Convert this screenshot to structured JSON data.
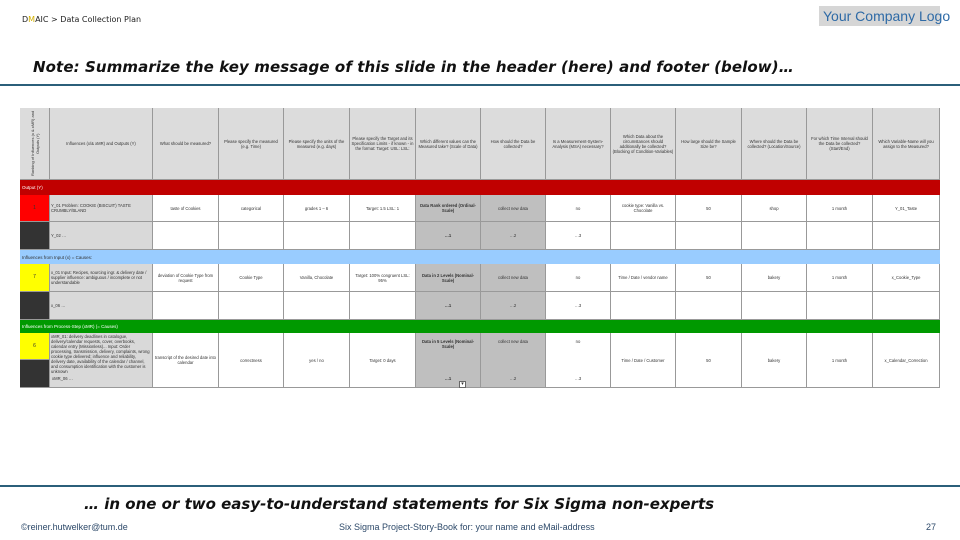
{
  "header": {
    "breadcrumb_prefix": "D",
    "breadcrumb_highlight": "M",
    "breadcrumb_suffix": "AIC > Data Collection Plan",
    "logo": "Your Company Logo",
    "note_top": "Note: Summarize the key message of this slide in the header (here) and footer (below)…"
  },
  "footer": {
    "note_bottom": "… in one or two easy-to-understand statements for Six Sigma non-experts",
    "copyright": "©reiner.hutwelker@tum.de",
    "book": "Six Sigma Project-Story-Book for: your name and eMail-address",
    "page_number": "27"
  },
  "table": {
    "columns": [
      "Ranking of Influences (x & xMR) and Outputs (Y)",
      "Influences (x/& xMR) and Outputs (Y)",
      "What should be measured?",
      "Please specify the measured (e.g. Time)",
      "Please specify the units of the measured (e.g. days)",
      "Please specify the Target and its Specification Limits - if known - in the format: Target: USL: LSL:",
      "Which different values can the Measured take? (Scale of Data)",
      "How should the Data be collected?",
      "Is a Measurement-System-Analysis (MSA) necessary?",
      "Which Data about the circumstances should additionally be collected? (Blocking of Condition-Variables)",
      "How large should the Sample Size be?",
      "Where should the Data be collected? (Location/Source)",
      "For which Time Interval should the Data be collected? (Start/End)",
      "Which Variable-Name will you assign to the Measured?"
    ],
    "sections": [
      {
        "title": "Output (Y)",
        "color": "#c00000",
        "rows": [
          {
            "rank": "1",
            "rank_color": "#ff0000",
            "cells": [
              "Y_01 Problem: COOKIE (BISCUIT) TASTE CRUMBLY/BLAND",
              "taste of Cookies",
              "categorical",
              "grades 1 – 6",
              "Target: 1.5 LSL: 1",
              "Data Rank ordered (Ordinal-Scale)",
              "collect new data",
              "no",
              "cookie type: Vanilla vs. Chocolate",
              "50",
              "shop",
              "1 month",
              "Y_01_Taste"
            ]
          },
          {
            "rank": "",
            "rank_color": "#333333",
            "cells": [
              "Y_02 …",
              "",
              "",
              "",
              "",
              "…1",
              "…2",
              "…3",
              "",
              "",
              "",
              "",
              ""
            ]
          }
        ]
      },
      {
        "title": "Influences from Input (x) = Causes:",
        "color": "#99ccff",
        "rows": [
          {
            "rank": "7",
            "rank_color": "#ffff00",
            "cells": [
              "x_01 Input: Recipes, sourcing ingr. & delivery date / supplier influence: ambiguous / incomplete or not understandable",
              "deviation of Cookie Type from request",
              "Cookie Type",
              "Vanilla, Chocolate",
              "Target: 100% congruent LSL: 95%",
              "Data in 2 Levels (Nominal-Scale)",
              "collect new data",
              "no",
              "Time / Date / vendor name",
              "50",
              "bakery",
              "1 month",
              "x_Cookie_Type"
            ]
          },
          {
            "rank": "",
            "rank_color": "#333333",
            "cells": [
              "x_06 …",
              "",
              "",
              "",
              "",
              "…1",
              "…2",
              "…3",
              "",
              "",
              "",
              "",
              ""
            ]
          }
        ]
      },
      {
        "title": "Influences from Process-Step (xMR) (= Causes)",
        "color": "#009900",
        "rows": [
          {
            "rank": "6",
            "rank_color": "#ffff00",
            "cells": [
              "xMR_01: delivery deadlines in catalogue, delivery/calendar requests, cover, overbooks, calendar entry (Missionless)... Input: Order processing, transmission, delivery, complaints, wrong cookie type delivered; influence and reliability, delivery date, availability of the calendar / channel, and consumption identification with the customer is unknown",
              "transcript of the desired date into calendar",
              "correctness",
              "yes / no",
              "Target: 0 days",
              "Data in 5 Levels (Nominal-Scale)",
              "collect new data",
              "no",
              "Time / Date / Customer",
              "50",
              "bakery",
              "1 month",
              "x_Calendar_Correction"
            ],
            "sub": "xMR_06 …",
            "sub_cells": [
              "…1",
              "…2",
              "…3"
            ]
          }
        ]
      }
    ]
  }
}
